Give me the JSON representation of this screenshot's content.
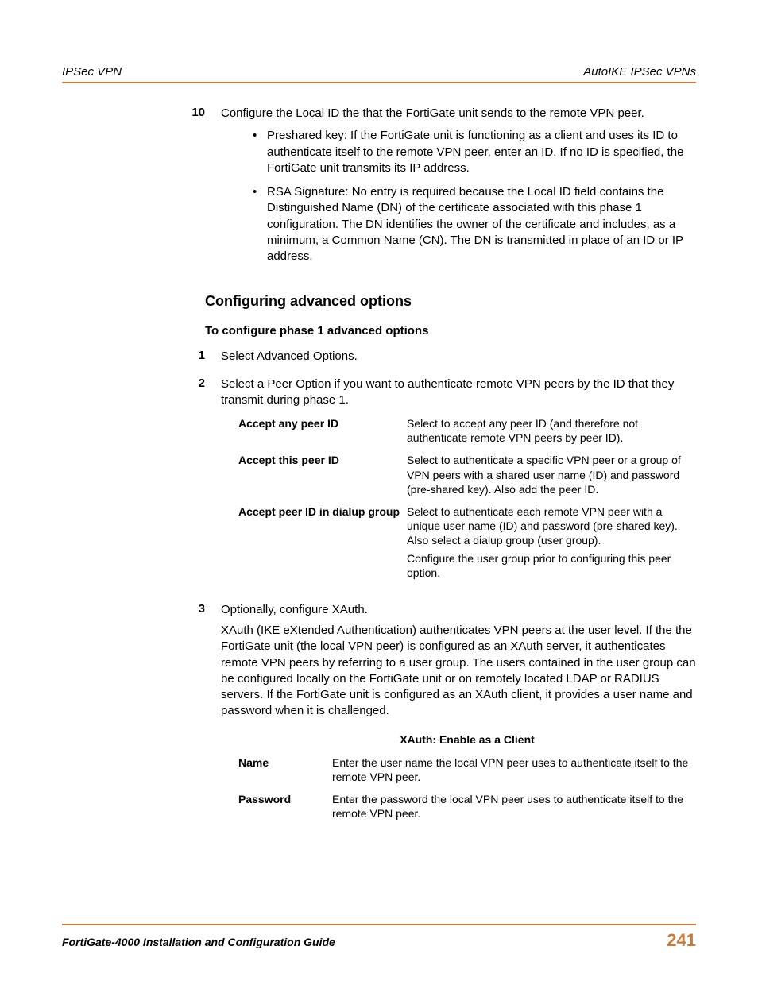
{
  "header": {
    "left": "IPSec VPN",
    "right": "AutoIKE IPSec VPNs"
  },
  "step10": {
    "num": "10",
    "text": "Configure the Local ID the that the FortiGate unit sends to the remote VPN peer.",
    "bullets": [
      "Preshared key: If the FortiGate unit is functioning as a client and uses its ID to authenticate itself to the remote VPN peer, enter an ID. If no ID is specified, the FortiGate unit transmits its IP address.",
      "RSA Signature: No entry is required because the Local ID field contains the Distinguished Name (DN) of the certificate associated with this phase 1 configuration. The DN identifies the owner of the certificate and includes, as a minimum, a Common Name (CN). The DN is transmitted in place of an ID or IP address."
    ]
  },
  "section": {
    "heading": "Configuring advanced options",
    "subheading": "To configure phase 1 advanced options"
  },
  "step1": {
    "num": "1",
    "text": "Select Advanced Options."
  },
  "step2": {
    "num": "2",
    "text": "Select a Peer Option if you want to authenticate remote VPN peers by the ID that they transmit during phase 1."
  },
  "options": [
    {
      "label": "Accept any peer ID",
      "desc": "Select to accept any peer ID (and therefore not authenticate remote VPN peers by peer ID)."
    },
    {
      "label": "Accept this peer ID",
      "desc": "Select to authenticate a specific VPN peer or a group of VPN peers with a shared user name (ID) and password (pre-shared key). Also add the peer ID."
    },
    {
      "label": "Accept peer ID in dialup group",
      "desc": "Select to authenticate each remote VPN peer with a unique user name (ID) and password (pre-shared key). Also select a dialup group (user group).",
      "desc2": "Configure the user group prior to configuring this peer option."
    }
  ],
  "step3": {
    "num": "3",
    "text": "Optionally, configure XAuth.",
    "para": "XAuth (IKE eXtended Authentication) authenticates VPN peers at the user level. If the the FortiGate unit (the local VPN peer) is configured as an XAuth server, it authenticates remote VPN peers by referring to a user group. The users contained in the user group can be configured locally on the FortiGate unit or on remotely located LDAP or RADIUS servers. If the FortiGate unit is configured as an XAuth client, it provides a user name and password when it is challenged."
  },
  "xauth": {
    "heading": "XAuth: Enable as a Client",
    "rows": [
      {
        "label": "Name",
        "desc": "Enter the user name the local VPN peer uses to authenticate itself to the remote VPN peer."
      },
      {
        "label": "Password",
        "desc": "Enter the password the local VPN peer uses to authenticate itself to the remote VPN peer."
      }
    ]
  },
  "footer": {
    "left": "FortiGate-4000 Installation and Configuration Guide",
    "right": "241"
  }
}
